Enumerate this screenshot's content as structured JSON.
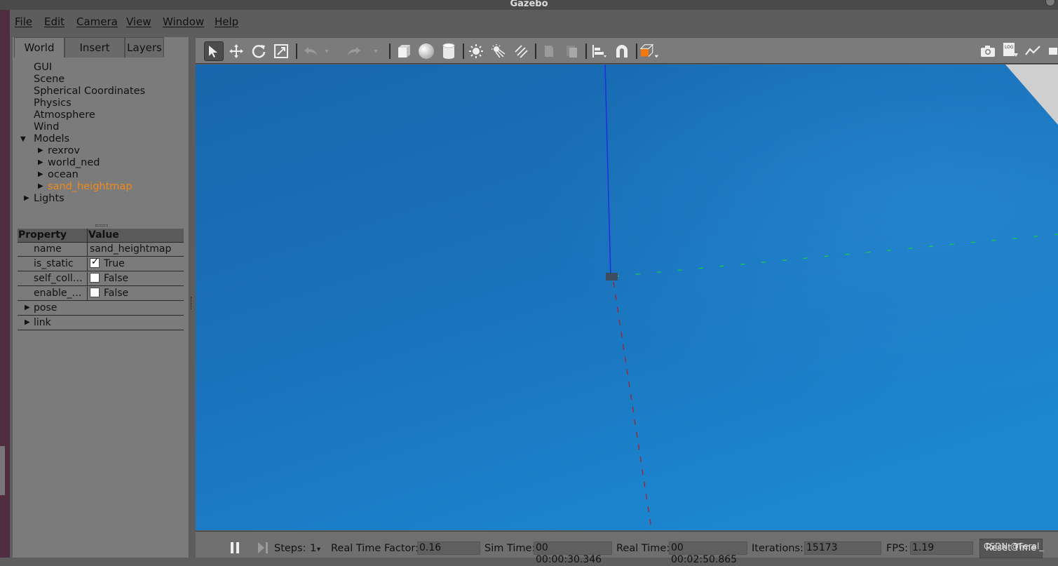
{
  "window": {
    "title": "Gazebo"
  },
  "menu": [
    "File",
    "Edit",
    "Camera",
    "View",
    "Window",
    "Help"
  ],
  "left_panel": {
    "tabs": [
      "World",
      "Insert",
      "Layers"
    ],
    "active_tab": "World",
    "tree": {
      "items": [
        "GUI",
        "Scene",
        "Spherical Coordinates",
        "Physics",
        "Atmosphere",
        "Wind"
      ],
      "models_label": "Models",
      "models": [
        "rexrov",
        "world_ned",
        "ocean",
        "sand_heightmap"
      ],
      "selected_model": "sand_heightmap",
      "lights_label": "Lights"
    },
    "properties": {
      "header": {
        "property": "Property",
        "value": "Value"
      },
      "rows": [
        {
          "key": "name",
          "value": "sand_heightmap",
          "type": "text"
        },
        {
          "key": "is_static",
          "value": "True",
          "type": "checkbox",
          "checked": true
        },
        {
          "key": "self_coll…",
          "value": "False",
          "type": "checkbox",
          "checked": false
        },
        {
          "key": "enable_…",
          "value": "False",
          "type": "checkbox",
          "checked": false
        }
      ],
      "groups": [
        "pose",
        "link"
      ]
    }
  },
  "toolbar": {
    "tools": [
      "select-tool",
      "translate-tool",
      "rotate-tool",
      "scale-tool",
      "undo",
      "redo",
      "box",
      "sphere",
      "cylinder",
      "point-light",
      "spot-light",
      "directional-light",
      "copy",
      "paste",
      "align",
      "snap",
      "view-angle"
    ],
    "right_tools": [
      "screenshot",
      "log",
      "plot",
      "video"
    ]
  },
  "viewport": {
    "colors": {
      "water": "#1a70b8",
      "z_axis": "#1f2ee0",
      "y_axis": "#1fd03a",
      "x_axis": "#b01a1a"
    }
  },
  "bottom_bar": {
    "steps_label": "Steps:",
    "steps_value": "1",
    "rtf_label": "Real Time Factor:",
    "rtf_value": "0.16",
    "sim_time_label": "Sim Time:",
    "sim_time_value": "00 00:00:30.346",
    "real_time_label": "Real Time:",
    "real_time_value": "00 00:02:50.865",
    "iterations_label": "Iterations:",
    "iterations_value": "15173",
    "fps_label": "FPS:",
    "fps_value": "1.19",
    "reset_label": "Reset Time",
    "watermark": "CSDN @Feral_"
  }
}
